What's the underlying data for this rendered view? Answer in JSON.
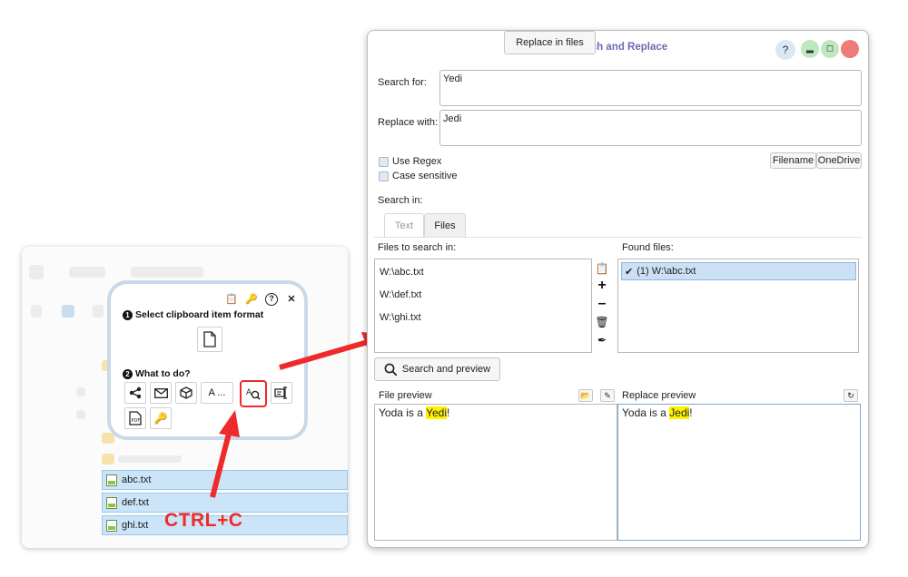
{
  "explorer": {
    "files": [
      "abc.txt",
      "def.txt",
      "ghi.txt"
    ]
  },
  "popup": {
    "step1": {
      "num": "1",
      "label": "Select clipboard item format"
    },
    "step2": {
      "num": "2",
      "label": "What to do?"
    },
    "font_button_label": "A ..."
  },
  "annotation": {
    "shortcut": "CTRL+C",
    "color": "#ee2a2a"
  },
  "dialog": {
    "title": "Search and Replace",
    "help_label": "?",
    "search_label": "Search for:",
    "search_value": "Yedi",
    "replace_label": "Replace with:",
    "replace_value": "Jedi",
    "options": {
      "use_regex": {
        "label": "Use Regex",
        "checked": false
      },
      "case_sensitive": {
        "label": "Case sensitive",
        "checked": false
      }
    },
    "filename_button": "Filename",
    "onedrive_button": "OneDrive",
    "search_in_label": "Search in:",
    "tabs": [
      {
        "label": "Text",
        "active": false
      },
      {
        "label": "Files",
        "active": true
      }
    ],
    "files_label": "Files to search in:",
    "files": [
      "W:\\abc.txt",
      "W:\\def.txt",
      "W:\\ghi.txt"
    ],
    "found_label": "Found files:",
    "found": [
      {
        "label": "(1) W:\\abc.txt",
        "checked": true
      }
    ],
    "search_button": "Search and preview",
    "replace_button": "Replace in files",
    "file_preview_label": "File preview",
    "replace_preview_label": "Replace preview",
    "file_preview": {
      "before": "Yoda is a ",
      "match": "Yedi",
      "after": "!"
    },
    "replace_preview": {
      "before": "Yoda is a ",
      "match": "Jedi",
      "after": "!"
    }
  }
}
